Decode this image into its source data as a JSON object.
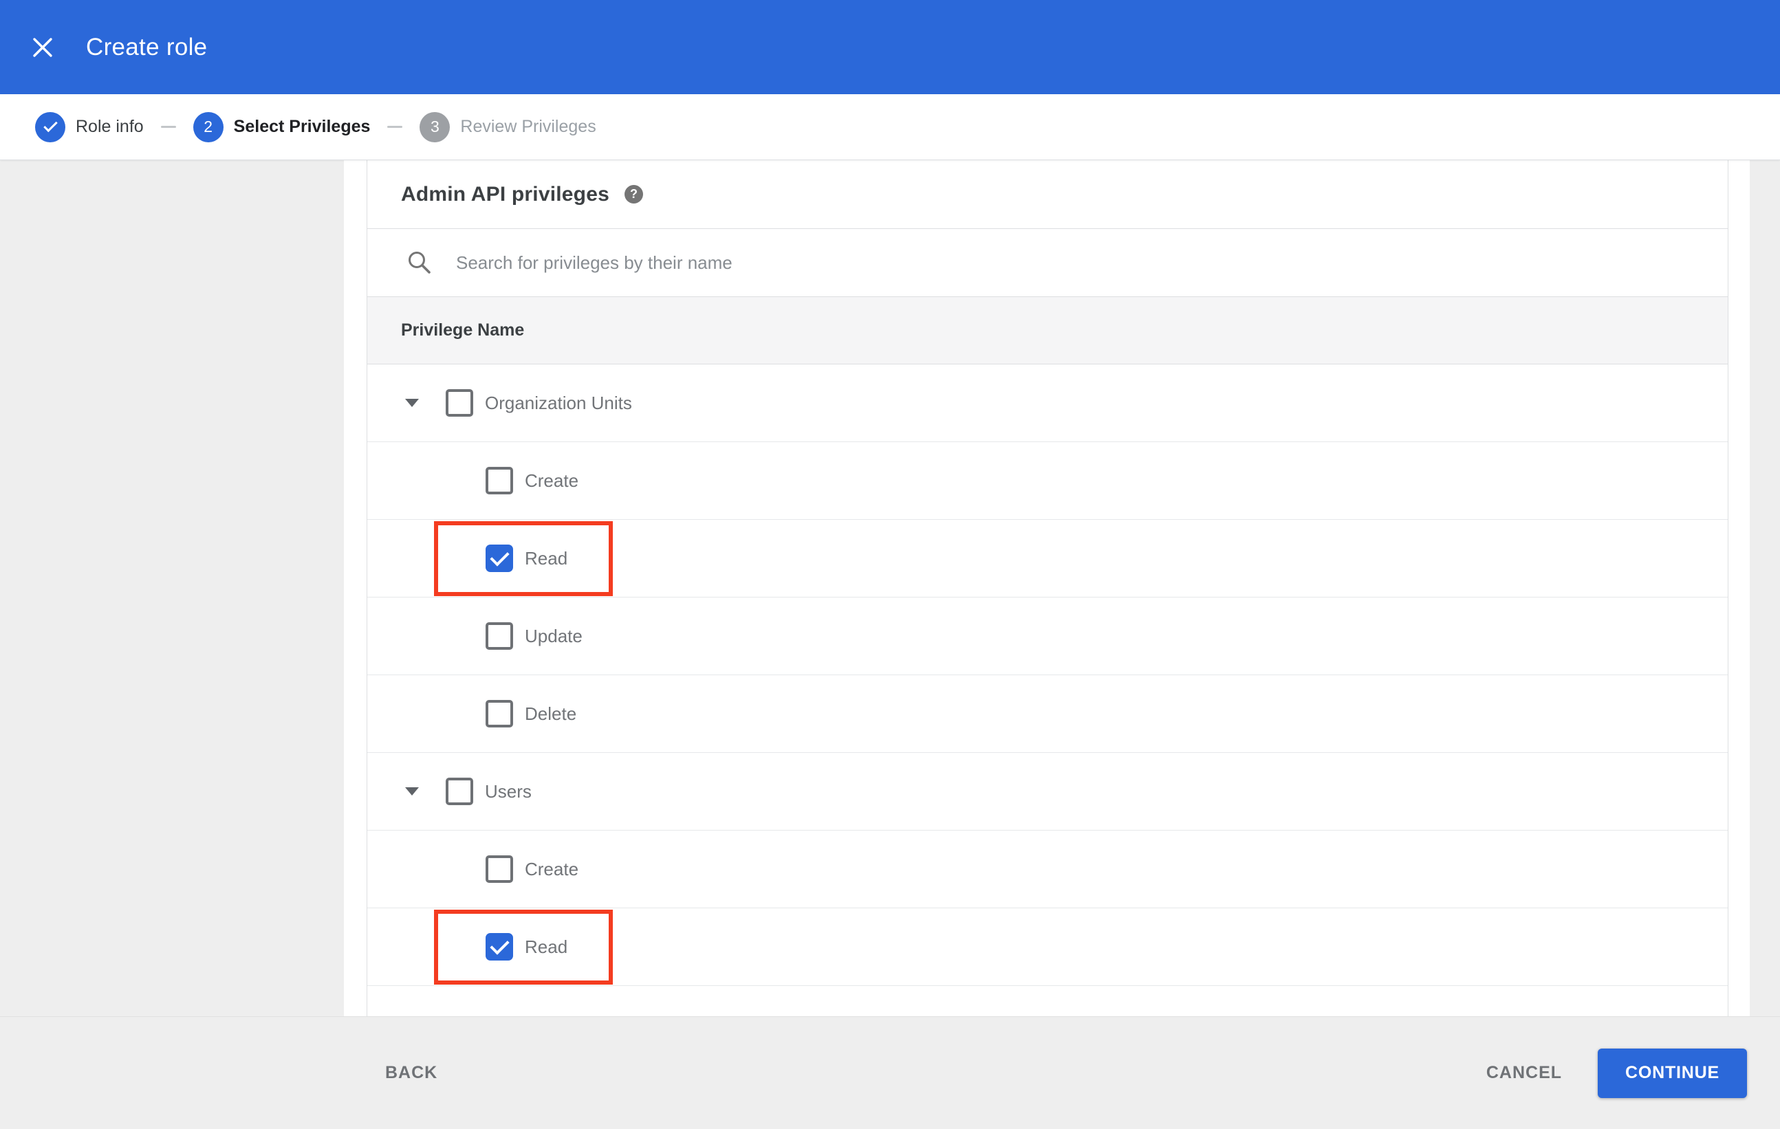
{
  "colors": {
    "accent": "#2b68d9",
    "highlight_red": "#f43c20",
    "page_bg": "#eeeeee",
    "panel_border": "#dddfe1",
    "divider": "#e6e8ea",
    "thead_bg": "#f5f5f6",
    "text_dark": "#3c4043",
    "text_body": "#717478",
    "text_disabled": "#9aa0a6",
    "placeholder": "#878c91",
    "icon_gray": "#757575",
    "step_inactive": "#9da0a4",
    "separator": "#c3c6c9",
    "footer_text": "#6f7276"
  },
  "header": {
    "title": "Create role"
  },
  "stepper": {
    "steps": [
      {
        "icon": "check-icon",
        "label": "Role info",
        "state": "completed"
      },
      {
        "num": "2",
        "label": "Select Privileges",
        "state": "current"
      },
      {
        "num": "3",
        "label": "Review Privileges",
        "state": "upcoming"
      }
    ]
  },
  "panel": {
    "title": "Admin API privileges",
    "help_glyph": "?",
    "search": {
      "placeholder": "Search for privileges by their name",
      "value": ""
    },
    "table": {
      "header": "Privilege Name",
      "rows": [
        {
          "label": "Organization Units",
          "type": "group",
          "expanded": true,
          "checked": false,
          "highlighted": false
        },
        {
          "label": "Create",
          "type": "child",
          "checked": false,
          "highlighted": false
        },
        {
          "label": "Read",
          "type": "child",
          "checked": true,
          "highlighted": true
        },
        {
          "label": "Update",
          "type": "child",
          "checked": false,
          "highlighted": false
        },
        {
          "label": "Delete",
          "type": "child",
          "checked": false,
          "highlighted": false
        },
        {
          "label": "Users",
          "type": "group",
          "expanded": true,
          "checked": false,
          "highlighted": false
        },
        {
          "label": "Create",
          "type": "child",
          "checked": false,
          "highlighted": false
        },
        {
          "label": "Read",
          "type": "child",
          "checked": true,
          "highlighted": true
        }
      ]
    }
  },
  "footer": {
    "back_label": "BACK",
    "cancel_label": "CANCEL",
    "continue_label": "CONTINUE"
  }
}
